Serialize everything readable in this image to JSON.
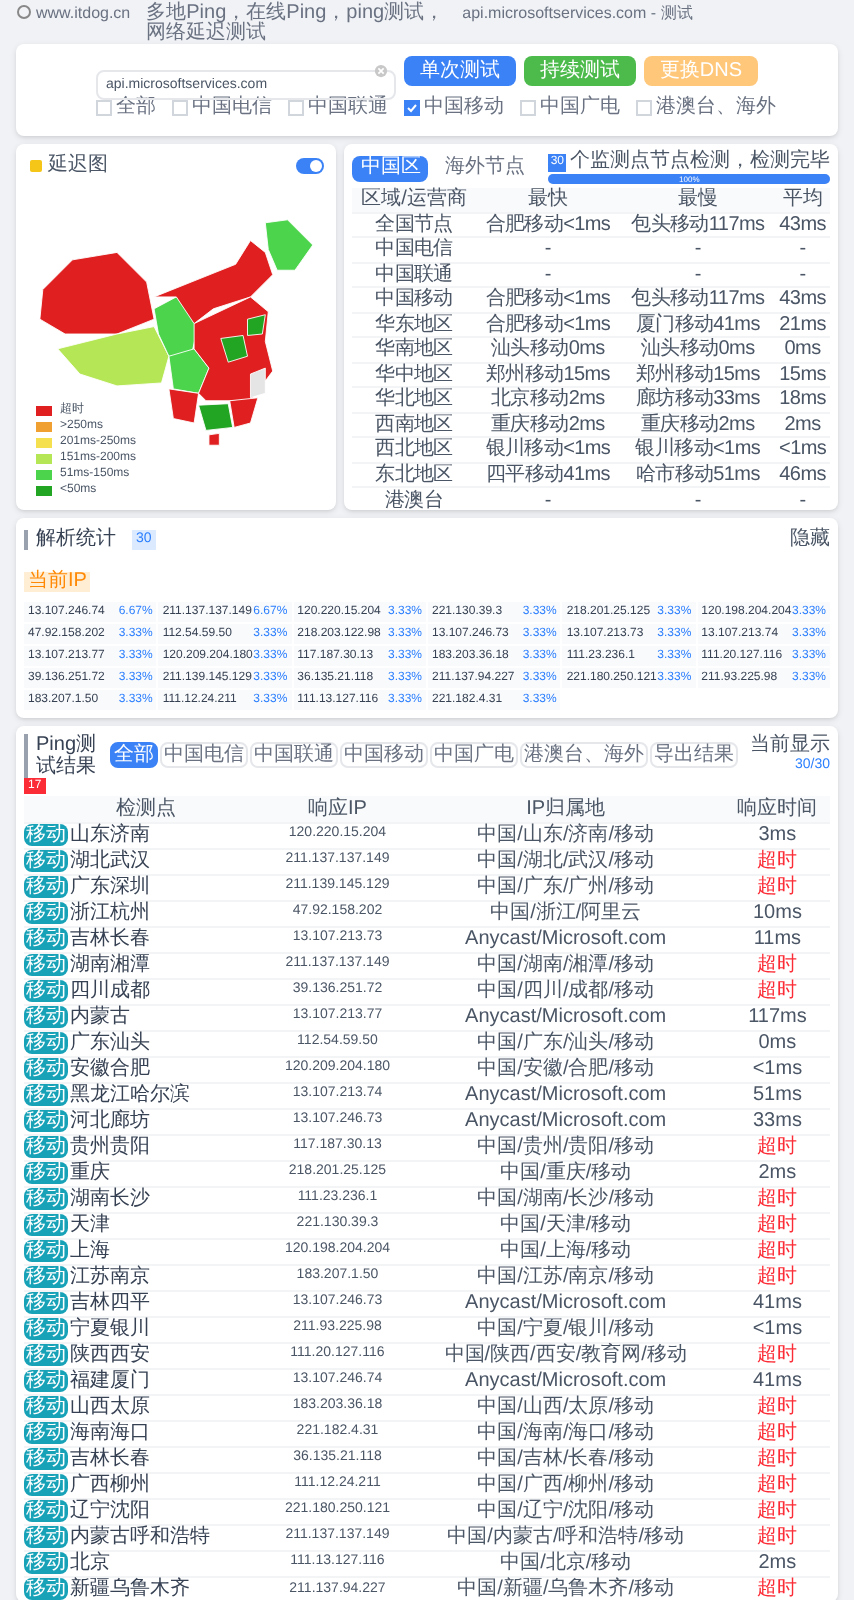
{
  "header": {
    "site": "www.itdog.cn",
    "tagline": "多地Ping，在线Ping，ping测试，网络延迟测试",
    "target": "api.microsoftservices.com - 测试"
  },
  "search": {
    "value": "api.microsoftservices.com",
    "buttons": [
      {
        "label": "单次测试",
        "kind": "primary"
      },
      {
        "label": "持续测试",
        "kind": "success"
      },
      {
        "label": "更换DNS",
        "kind": "warning"
      }
    ],
    "filters": [
      {
        "label": "全部",
        "checked": false
      },
      {
        "label": "中国电信",
        "checked": false
      },
      {
        "label": "中国联通",
        "checked": false
      },
      {
        "label": "中国移动",
        "checked": true
      },
      {
        "label": "中国广电",
        "checked": false
      },
      {
        "label": "港澳台、海外",
        "checked": false
      }
    ]
  },
  "map": {
    "title": "延迟图",
    "toggle_on": true,
    "legend": [
      {
        "label": "超时",
        "color": "#e02020"
      },
      {
        "label": ">250ms",
        "color": "#f0a030"
      },
      {
        "label": "201ms-250ms",
        "color": "#f5e050"
      },
      {
        "label": "151ms-200ms",
        "color": "#b5e655"
      },
      {
        "label": "51ms-150ms",
        "color": "#4cd44c"
      },
      {
        "label": "<50ms",
        "color": "#22a522"
      }
    ]
  },
  "summary": {
    "tabs": [
      {
        "label": "中国区",
        "selected": true
      },
      {
        "label": "海外节点",
        "selected": false
      }
    ],
    "progress": {
      "badge": "30",
      "text": "个监测点节点检测，检测完毕",
      "level": 1,
      "reading": "100%"
    },
    "columns": [
      "区域/运营商",
      "最快",
      "最慢",
      "平均"
    ],
    "rows": [
      [
        "全国节点",
        "合肥移动<1ms",
        "包头移动117ms",
        "43ms"
      ],
      [
        "中国电信",
        "-",
        "-",
        "-"
      ],
      [
        "中国联通",
        "-",
        "-",
        "-"
      ],
      [
        "中国移动",
        "合肥移动<1ms",
        "包头移动117ms",
        "43ms"
      ],
      [
        "华东地区",
        "合肥移动<1ms",
        "厦门移动41ms",
        "21ms"
      ],
      [
        "华南地区",
        "汕头移动0ms",
        "汕头移动0ms",
        "0ms"
      ],
      [
        "华中地区",
        "郑州移动15ms",
        "郑州移动15ms",
        "15ms"
      ],
      [
        "华北地区",
        "北京移动2ms",
        "廊坊移动33ms",
        "18ms"
      ],
      [
        "西南地区",
        "重庆移动2ms",
        "重庆移动2ms",
        "2ms"
      ],
      [
        "西北地区",
        "银川移动<1ms",
        "银川移动<1ms",
        "<1ms"
      ],
      [
        "东北地区",
        "四平移动41ms",
        "哈市移动51ms",
        "46ms"
      ],
      [
        "港澳台",
        "-",
        "-",
        "-"
      ]
    ]
  },
  "resolution": {
    "title": "解析统计",
    "count": "30",
    "tag": "当前IP",
    "toggle": "隐藏",
    "entries": [
      {
        "ip": "13.107.246.74",
        "share": "6.67%"
      },
      {
        "ip": "211.137.137.149",
        "share": "6.67%"
      },
      {
        "ip": "120.220.15.204",
        "share": "3.33%"
      },
      {
        "ip": "221.130.39.3",
        "share": "3.33%"
      },
      {
        "ip": "218.201.25.125",
        "share": "3.33%"
      },
      {
        "ip": "120.198.204.204",
        "share": "3.33%"
      },
      {
        "ip": "47.92.158.202",
        "share": "3.33%"
      },
      {
        "ip": "112.54.59.50",
        "share": "3.33%"
      },
      {
        "ip": "218.203.122.98",
        "share": "3.33%"
      },
      {
        "ip": "13.107.246.73",
        "share": "3.33%"
      },
      {
        "ip": "13.107.213.73",
        "share": "3.33%"
      },
      {
        "ip": "13.107.213.74",
        "share": "3.33%"
      },
      {
        "ip": "13.107.213.77",
        "share": "3.33%"
      },
      {
        "ip": "120.209.204.180",
        "share": "3.33%"
      },
      {
        "ip": "117.187.30.13",
        "share": "3.33%"
      },
      {
        "ip": "183.203.36.18",
        "share": "3.33%"
      },
      {
        "ip": "111.23.236.1",
        "share": "3.33%"
      },
      {
        "ip": "111.20.127.116",
        "share": "3.33%"
      },
      {
        "ip": "39.136.251.72",
        "share": "3.33%"
      },
      {
        "ip": "211.139.145.129",
        "share": "3.33%"
      },
      {
        "ip": "36.135.21.118",
        "share": "3.33%"
      },
      {
        "ip": "211.137.94.227",
        "share": "3.33%"
      },
      {
        "ip": "221.180.250.121",
        "share": "3.33%"
      },
      {
        "ip": "211.93.225.98",
        "share": "3.33%"
      },
      {
        "ip": "183.207.1.50",
        "share": "3.33%"
      },
      {
        "ip": "111.12.24.211",
        "share": "3.33%"
      },
      {
        "ip": "111.13.127.116",
        "share": "3.33%"
      },
      {
        "ip": "221.182.4.31",
        "share": "3.33%"
      }
    ]
  },
  "ping": {
    "title": "Ping测试结果",
    "badge": "17",
    "filters": [
      {
        "label": "全部",
        "selected": true
      },
      {
        "label": "中国电信",
        "selected": false
      },
      {
        "label": "中国联通",
        "selected": false
      },
      {
        "label": "中国移动",
        "selected": false
      },
      {
        "label": "中国广电",
        "selected": false
      },
      {
        "label": "港澳台、海外",
        "selected": false
      },
      {
        "label": "导出结果",
        "selected": false
      }
    ],
    "shown_label": "当前显示",
    "shown": "30/30",
    "columns": [
      "检测点",
      "响应IP",
      "IP归属地",
      "响应时间"
    ],
    "rows": [
      {
        "isp": "移动",
        "node": "山东济南",
        "ip": "120.220.15.204",
        "location": "中国/山东/济南/移动",
        "time": "3ms",
        "timeout": false
      },
      {
        "isp": "移动",
        "node": "湖北武汉",
        "ip": "211.137.137.149",
        "location": "中国/湖北/武汉/移动",
        "time": "超时",
        "timeout": true
      },
      {
        "isp": "移动",
        "node": "广东深圳",
        "ip": "211.139.145.129",
        "location": "中国/广东/广州/移动",
        "time": "超时",
        "timeout": true
      },
      {
        "isp": "移动",
        "node": "浙江杭州",
        "ip": "47.92.158.202",
        "location": "中国/浙江/阿里云",
        "time": "10ms",
        "timeout": false
      },
      {
        "isp": "移动",
        "node": "吉林长春",
        "ip": "13.107.213.73",
        "location": "Anycast/Microsoft.com",
        "time": "11ms",
        "timeout": false
      },
      {
        "isp": "移动",
        "node": "湖南湘潭",
        "ip": "211.137.137.149",
        "location": "中国/湖南/湘潭/移动",
        "time": "超时",
        "timeout": true
      },
      {
        "isp": "移动",
        "node": "四川成都",
        "ip": "39.136.251.72",
        "location": "中国/四川/成都/移动",
        "time": "超时",
        "timeout": true
      },
      {
        "isp": "移动",
        "node": "内蒙古",
        "ip": "13.107.213.77",
        "location": "Anycast/Microsoft.com",
        "time": "117ms",
        "timeout": false
      },
      {
        "isp": "移动",
        "node": "广东汕头",
        "ip": "112.54.59.50",
        "location": "中国/广东/汕头/移动",
        "time": "0ms",
        "timeout": false
      },
      {
        "isp": "移动",
        "node": "安徽合肥",
        "ip": "120.209.204.180",
        "location": "中国/安徽/合肥/移动",
        "time": "<1ms",
        "timeout": false
      },
      {
        "isp": "移动",
        "node": "黑龙江哈尔滨",
        "ip": "13.107.213.74",
        "location": "Anycast/Microsoft.com",
        "time": "51ms",
        "timeout": false
      },
      {
        "isp": "移动",
        "node": "河北廊坊",
        "ip": "13.107.246.73",
        "location": "Anycast/Microsoft.com",
        "time": "33ms",
        "timeout": false
      },
      {
        "isp": "移动",
        "node": "贵州贵阳",
        "ip": "117.187.30.13",
        "location": "中国/贵州/贵阳/移动",
        "time": "超时",
        "timeout": true
      },
      {
        "isp": "移动",
        "node": "重庆",
        "ip": "218.201.25.125",
        "location": "中国/重庆/移动",
        "time": "2ms",
        "timeout": false
      },
      {
        "isp": "移动",
        "node": "湖南长沙",
        "ip": "111.23.236.1",
        "location": "中国/湖南/长沙/移动",
        "time": "超时",
        "timeout": true
      },
      {
        "isp": "移动",
        "node": "天津",
        "ip": "221.130.39.3",
        "location": "中国/天津/移动",
        "time": "超时",
        "timeout": true
      },
      {
        "isp": "移动",
        "node": "上海",
        "ip": "120.198.204.204",
        "location": "中国/上海/移动",
        "time": "超时",
        "timeout": true
      },
      {
        "isp": "移动",
        "node": "江苏南京",
        "ip": "183.207.1.50",
        "location": "中国/江苏/南京/移动",
        "time": "超时",
        "timeout": true
      },
      {
        "isp": "移动",
        "node": "吉林四平",
        "ip": "13.107.246.73",
        "location": "Anycast/Microsoft.com",
        "time": "41ms",
        "timeout": false
      },
      {
        "isp": "移动",
        "node": "宁夏银川",
        "ip": "211.93.225.98",
        "location": "中国/宁夏/银川/移动",
        "time": "<1ms",
        "timeout": false
      },
      {
        "isp": "移动",
        "node": "陕西西安",
        "ip": "111.20.127.116",
        "location": "中国/陕西/西安/教育网/移动",
        "time": "超时",
        "timeout": true
      },
      {
        "isp": "移动",
        "node": "福建厦门",
        "ip": "13.107.246.74",
        "location": "Anycast/Microsoft.com",
        "time": "41ms",
        "timeout": false
      },
      {
        "isp": "移动",
        "node": "山西太原",
        "ip": "183.203.36.18",
        "location": "中国/山西/太原/移动",
        "time": "超时",
        "timeout": true
      },
      {
        "isp": "移动",
        "node": "海南海口",
        "ip": "221.182.4.31",
        "location": "中国/海南/海口/移动",
        "time": "超时",
        "timeout": true
      },
      {
        "isp": "移动",
        "node": "吉林长春",
        "ip": "36.135.21.118",
        "location": "中国/吉林/长春/移动",
        "time": "超时",
        "timeout": true
      },
      {
        "isp": "移动",
        "node": "广西柳州",
        "ip": "111.12.24.211",
        "location": "中国/广西/柳州/移动",
        "time": "超时",
        "timeout": true
      },
      {
        "isp": "移动",
        "node": "辽宁沈阳",
        "ip": "221.180.250.121",
        "location": "中国/辽宁/沈阳/移动",
        "time": "超时",
        "timeout": true
      },
      {
        "isp": "移动",
        "node": "内蒙古呼和浩特",
        "ip": "211.137.137.149",
        "location": "中国/内蒙古/呼和浩特/移动",
        "time": "超时",
        "timeout": true
      },
      {
        "isp": "移动",
        "node": "北京",
        "ip": "111.13.127.116",
        "location": "中国/北京/移动",
        "time": "2ms",
        "timeout": false
      },
      {
        "isp": "移动",
        "node": "新疆乌鲁木齐",
        "ip": "211.137.94.227",
        "location": "中国/新疆/乌鲁木齐/移动",
        "time": "超时",
        "timeout": true
      }
    ]
  }
}
